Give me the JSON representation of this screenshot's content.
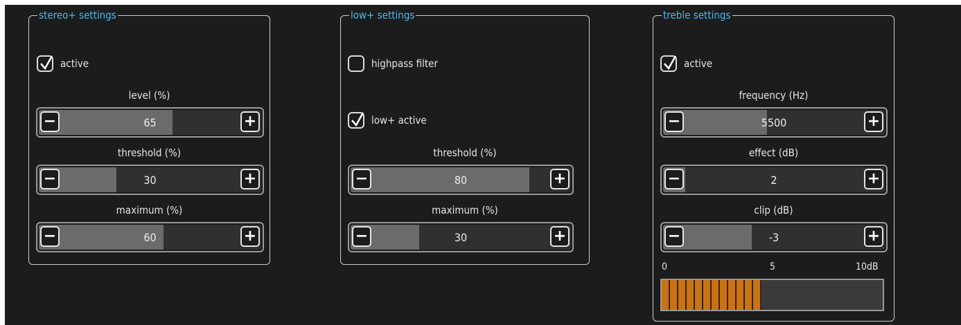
{
  "stereo": {
    "title": "stereo+ settings",
    "active_label": "active",
    "active_checked": true,
    "level": {
      "label": "level (%)",
      "value": "65",
      "fraction": 0.6
    },
    "threshold": {
      "label": "threshold (%)",
      "value": "30",
      "fraction": 0.35
    },
    "maximum": {
      "label": "maximum (%)",
      "value": "60",
      "fraction": 0.56
    }
  },
  "low": {
    "title": "low+ settings",
    "highpass_label": "highpass filter",
    "highpass_checked": false,
    "low_active_label": "low+ active",
    "low_active_checked": true,
    "threshold": {
      "label": "threshold (%)",
      "value": "80",
      "fraction": 0.81
    },
    "maximum": {
      "label": "maximum (%)",
      "value": "30",
      "fraction": 0.31
    }
  },
  "treble": {
    "title": "treble settings",
    "active_label": "active",
    "active_checked": true,
    "frequency": {
      "label": "frequency (Hz)",
      "value": "5500",
      "fraction": 0.47
    },
    "effect": {
      "label": "effect (dB)",
      "value": "2",
      "fraction": 0.1
    },
    "clip": {
      "label": "clip (dB)",
      "value": "-3",
      "fraction": 0.4
    },
    "meter": {
      "scale": [
        "0",
        "5",
        "10dB"
      ],
      "level_fraction": 0.45,
      "color": "#c87316"
    }
  },
  "buttons": {
    "minus": "−",
    "plus": "+"
  },
  "colors": {
    "title": "#4fb8e8",
    "background": "#1c1c1c"
  }
}
